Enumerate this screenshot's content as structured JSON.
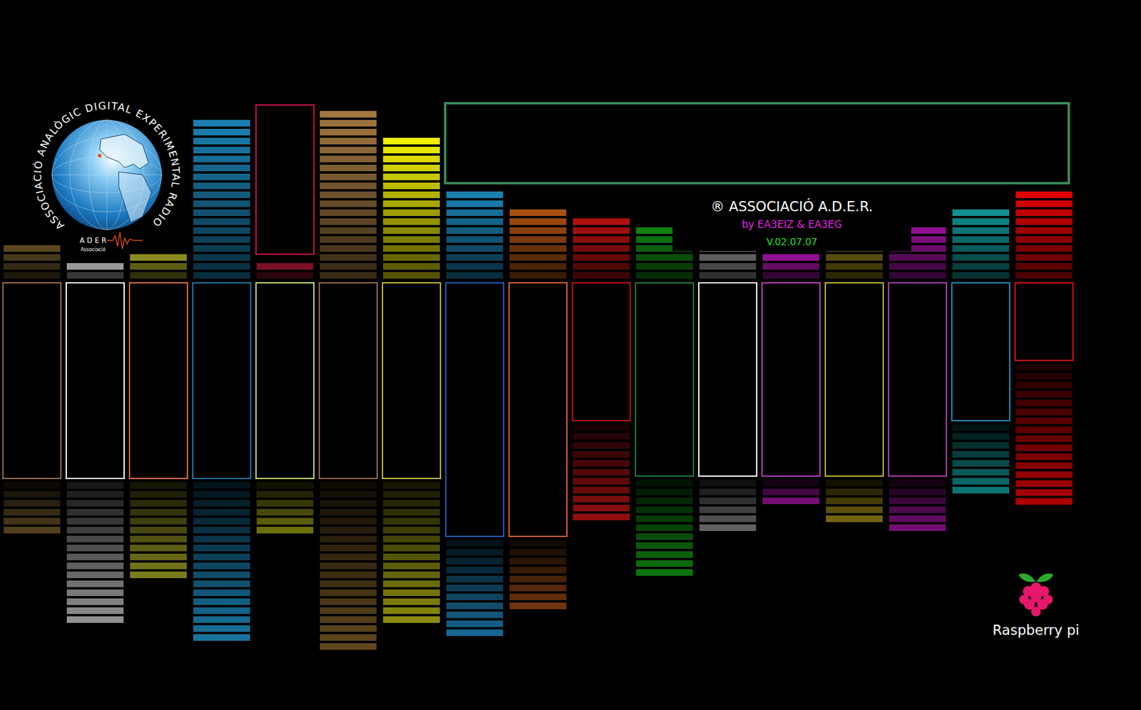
{
  "logo": {
    "ring_text": "ASSOCIACIÓ ANALÒGIC DIGITAL EXPERIMENTAL RADIO",
    "name": "A D E R",
    "sub": "Associació"
  },
  "brand": {
    "title": "® ASSOCIACIÓ A.D.E.R.",
    "subtitle": "by EA3EIZ & EA3EG",
    "version": "V.02.07.07"
  },
  "channels": [
    {
      "color": "#5a4620",
      "lower_color": "#5a4620",
      "box_color": "#a0704a",
      "level": 0.13,
      "box_level": 0.75,
      "lower_level": 0.2,
      "peak_level": 0
    },
    {
      "color": "#9a9a9a",
      "lower_color": "#a0a0a0",
      "box_color": "#ffffff",
      "level": 0.07,
      "box_level": 0.75,
      "lower_level": 0.53,
      "peak_level": 0
    },
    {
      "color": "#8a8a20",
      "lower_color": "#8a8a20",
      "box_color": "#e07040",
      "level": 0.1,
      "box_level": 0.75,
      "lower_level": 0.37,
      "peak_level": 0
    },
    {
      "color": "#1a80b0",
      "lower_color": "#1a80b0",
      "box_color": "#1a7ab0",
      "level": 0.6,
      "box_level": 0.75,
      "lower_level": 0.6,
      "peak_level": 0
    },
    {
      "color": "#7a1028",
      "lower_color": "#7a7a10",
      "box_color": "#c8e070",
      "level": 0.07,
      "box_level": 0.75,
      "lower_level": 0.2,
      "peak_level": 0.54,
      "peak_color": "#d01050"
    },
    {
      "color": "#a07840",
      "lower_color": "#6a5020",
      "box_color": "#9a6a50",
      "level": 0.63,
      "box_level": 0.75,
      "lower_level": 0.63,
      "peak_level": 0
    },
    {
      "color": "#f0f000",
      "lower_color": "#9a9a10",
      "box_color": "#c8c040",
      "level": 0.53,
      "box_level": 0.75,
      "lower_level": 0.53,
      "peak_level": 0
    },
    {
      "color": "#1a80b0",
      "lower_color": "#1a70a0",
      "box_color": "#2060c0",
      "level": 0.33,
      "box_level": 0.97,
      "lower_level": 0.37,
      "peak_level": 0
    },
    {
      "color": "#a85010",
      "lower_color": "#7a3a10",
      "box_color": "#e06030",
      "level": 0.27,
      "box_level": 0.97,
      "lower_level": 0.27,
      "peak_level": 0
    },
    {
      "color": "#b01010",
      "lower_color": "#a01010",
      "box_color": "#c01010",
      "level": 0.23,
      "box_level": 0.53,
      "lower_level": 0.37,
      "peak_level": 0
    },
    {
      "color": "#108010",
      "lower_color": "#108010",
      "box_color": "#208040",
      "level": 0.2,
      "box_level": 0.74,
      "lower_level": 0.37,
      "peak_level": 0
    },
    {
      "color": "#8a8a8a",
      "lower_color": "#6a6a6a",
      "box_color": "#ffffff",
      "level": 0.17,
      "box_level": 0.74,
      "lower_level": 0.2,
      "peak_level": 0
    },
    {
      "color": "#901090",
      "lower_color": "#801080",
      "box_color": "#c040c0",
      "level": 0.1,
      "box_level": 0.74,
      "lower_level": 0.1,
      "peak_level": 0
    },
    {
      "color": "#807010",
      "lower_color": "#807010",
      "box_color": "#c0c030",
      "level": 0.17,
      "box_level": 0.74,
      "lower_level": 0.17,
      "peak_level": 0
    },
    {
      "color": "#901090",
      "lower_color": "#801080",
      "box_color": "#b040b0",
      "level": 0.2,
      "box_level": 0.74,
      "lower_level": 0.2,
      "peak_level": 0
    },
    {
      "color": "#109090",
      "lower_color": "#108080",
      "box_color": "#2090c0",
      "level": 0.27,
      "box_level": 0.53,
      "lower_level": 0.27,
      "peak_level": 0
    },
    {
      "color": "#e00000",
      "lower_color": "#c00000",
      "box_color": "#e01010",
      "level": 0.33,
      "box_level": 0.3,
      "lower_level": 0.53,
      "peak_level": 0
    }
  ],
  "platform": {
    "label": "Raspberry pi"
  }
}
